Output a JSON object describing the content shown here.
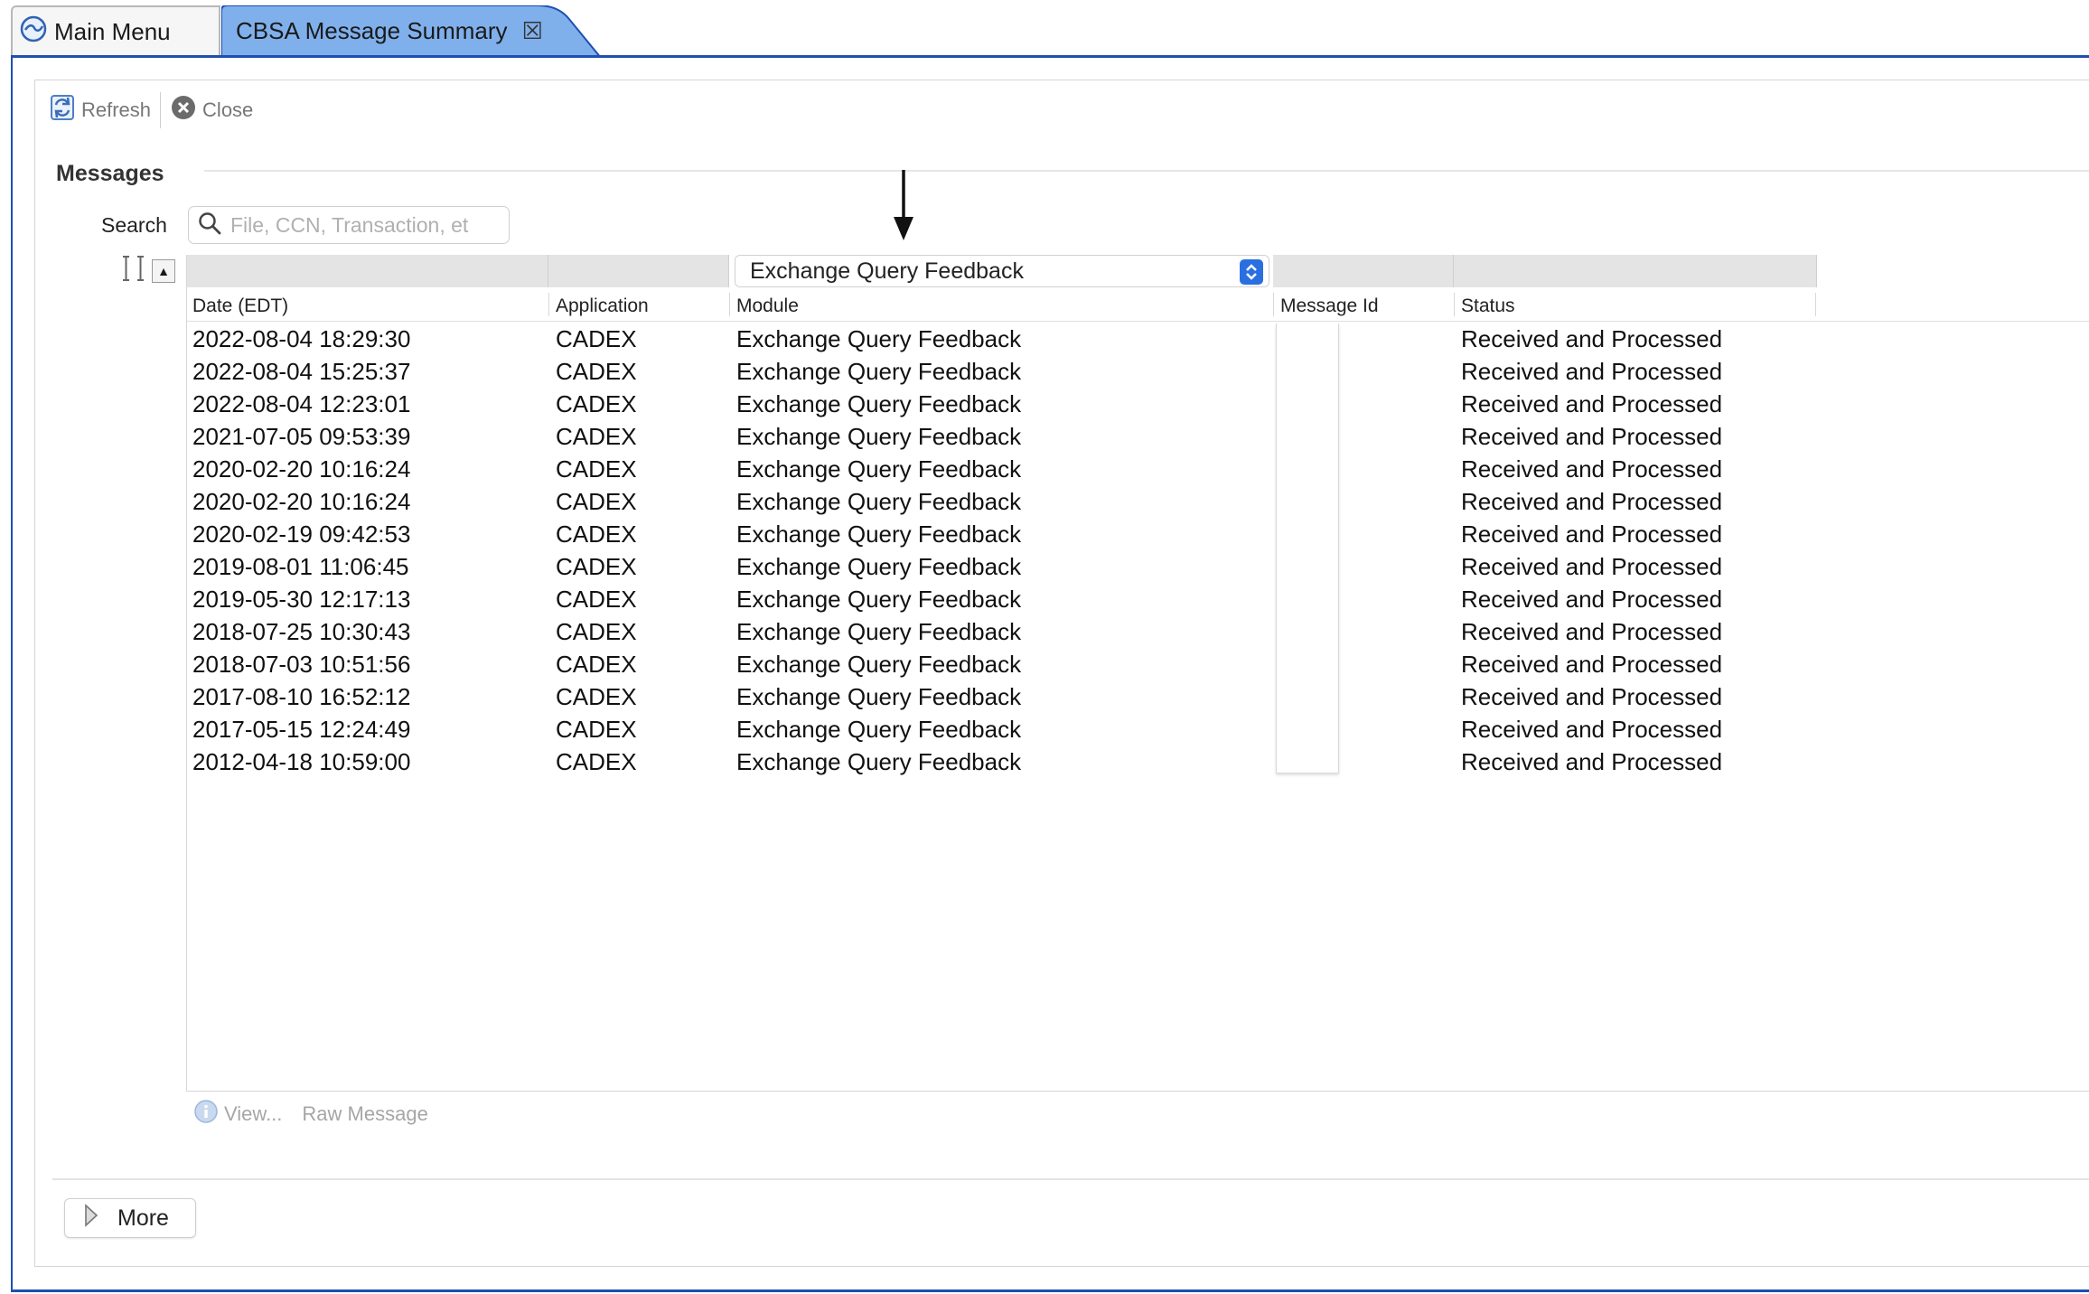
{
  "tabs": [
    {
      "label": "Main Menu",
      "active": false
    },
    {
      "label": "CBSA Message Summary",
      "active": true,
      "close_glyph": "☒"
    }
  ],
  "toolbar": {
    "refresh_label": "Refresh",
    "close_label": "Close"
  },
  "section": {
    "title": "Messages"
  },
  "search": {
    "label": "Search",
    "placeholder": "File, CCN, Transaction, et",
    "value": ""
  },
  "filter": {
    "module_selected": "Exchange Query Feedback",
    "sort_glyph": "▲"
  },
  "table": {
    "columns": [
      "Date (EDT)",
      "Application",
      "Module",
      "Message Id",
      "Status"
    ],
    "rows": [
      {
        "date": "2022-08-04 18:29:30",
        "application": "CADEX",
        "module": "Exchange Query Feedback",
        "message_id": "",
        "status": "Received and Processed"
      },
      {
        "date": "2022-08-04 15:25:37",
        "application": "CADEX",
        "module": "Exchange Query Feedback",
        "message_id": "",
        "status": "Received and Processed"
      },
      {
        "date": "2022-08-04 12:23:01",
        "application": "CADEX",
        "module": "Exchange Query Feedback",
        "message_id": "",
        "status": "Received and Processed"
      },
      {
        "date": "2021-07-05 09:53:39",
        "application": "CADEX",
        "module": "Exchange Query Feedback",
        "message_id": "",
        "status": "Received and Processed"
      },
      {
        "date": "2020-02-20 10:16:24",
        "application": "CADEX",
        "module": "Exchange Query Feedback",
        "message_id": "",
        "status": "Received and Processed"
      },
      {
        "date": "2020-02-20 10:16:24",
        "application": "CADEX",
        "module": "Exchange Query Feedback",
        "message_id": "",
        "status": "Received and Processed"
      },
      {
        "date": "2020-02-19 09:42:53",
        "application": "CADEX",
        "module": "Exchange Query Feedback",
        "message_id": "",
        "status": "Received and Processed"
      },
      {
        "date": "2019-08-01 11:06:45",
        "application": "CADEX",
        "module": "Exchange Query Feedback",
        "message_id": "",
        "status": "Received and Processed"
      },
      {
        "date": "2019-05-30 12:17:13",
        "application": "CADEX",
        "module": "Exchange Query Feedback",
        "message_id": "",
        "status": "Received and Processed"
      },
      {
        "date": "2018-07-25 10:30:43",
        "application": "CADEX",
        "module": "Exchange Query Feedback",
        "message_id": "",
        "status": "Received and Processed"
      },
      {
        "date": "2018-07-03 10:51:56",
        "application": "CADEX",
        "module": "Exchange Query Feedback",
        "message_id": "",
        "status": "Received and Processed"
      },
      {
        "date": "2017-08-10 16:52:12",
        "application": "CADEX",
        "module": "Exchange Query Feedback",
        "message_id": "",
        "status": "Received and Processed"
      },
      {
        "date": "2017-05-15 12:24:49",
        "application": "CADEX",
        "module": "Exchange Query Feedback",
        "message_id": "",
        "status": "Received and Processed"
      },
      {
        "date": "2012-04-18 10:59:00",
        "application": "CADEX",
        "module": "Exchange Query Feedback",
        "message_id": "",
        "status": "Received and Processed"
      }
    ]
  },
  "actions": {
    "view_label": "View...",
    "raw_label": "Raw Message"
  },
  "more": {
    "label": "More"
  },
  "colors": {
    "accent": "#1f4fb0",
    "active_tab": "#7fb0ec",
    "select_button": "#2a6fe0"
  },
  "icons": [
    "app-logo-icon",
    "tab-close-icon",
    "refresh-icon",
    "close-circle-icon",
    "search-icon",
    "column-resize-icon",
    "sort-up-icon",
    "select-chevrons-icon",
    "info-icon",
    "disclosure-triangle-icon",
    "down-arrow-annotation"
  ]
}
